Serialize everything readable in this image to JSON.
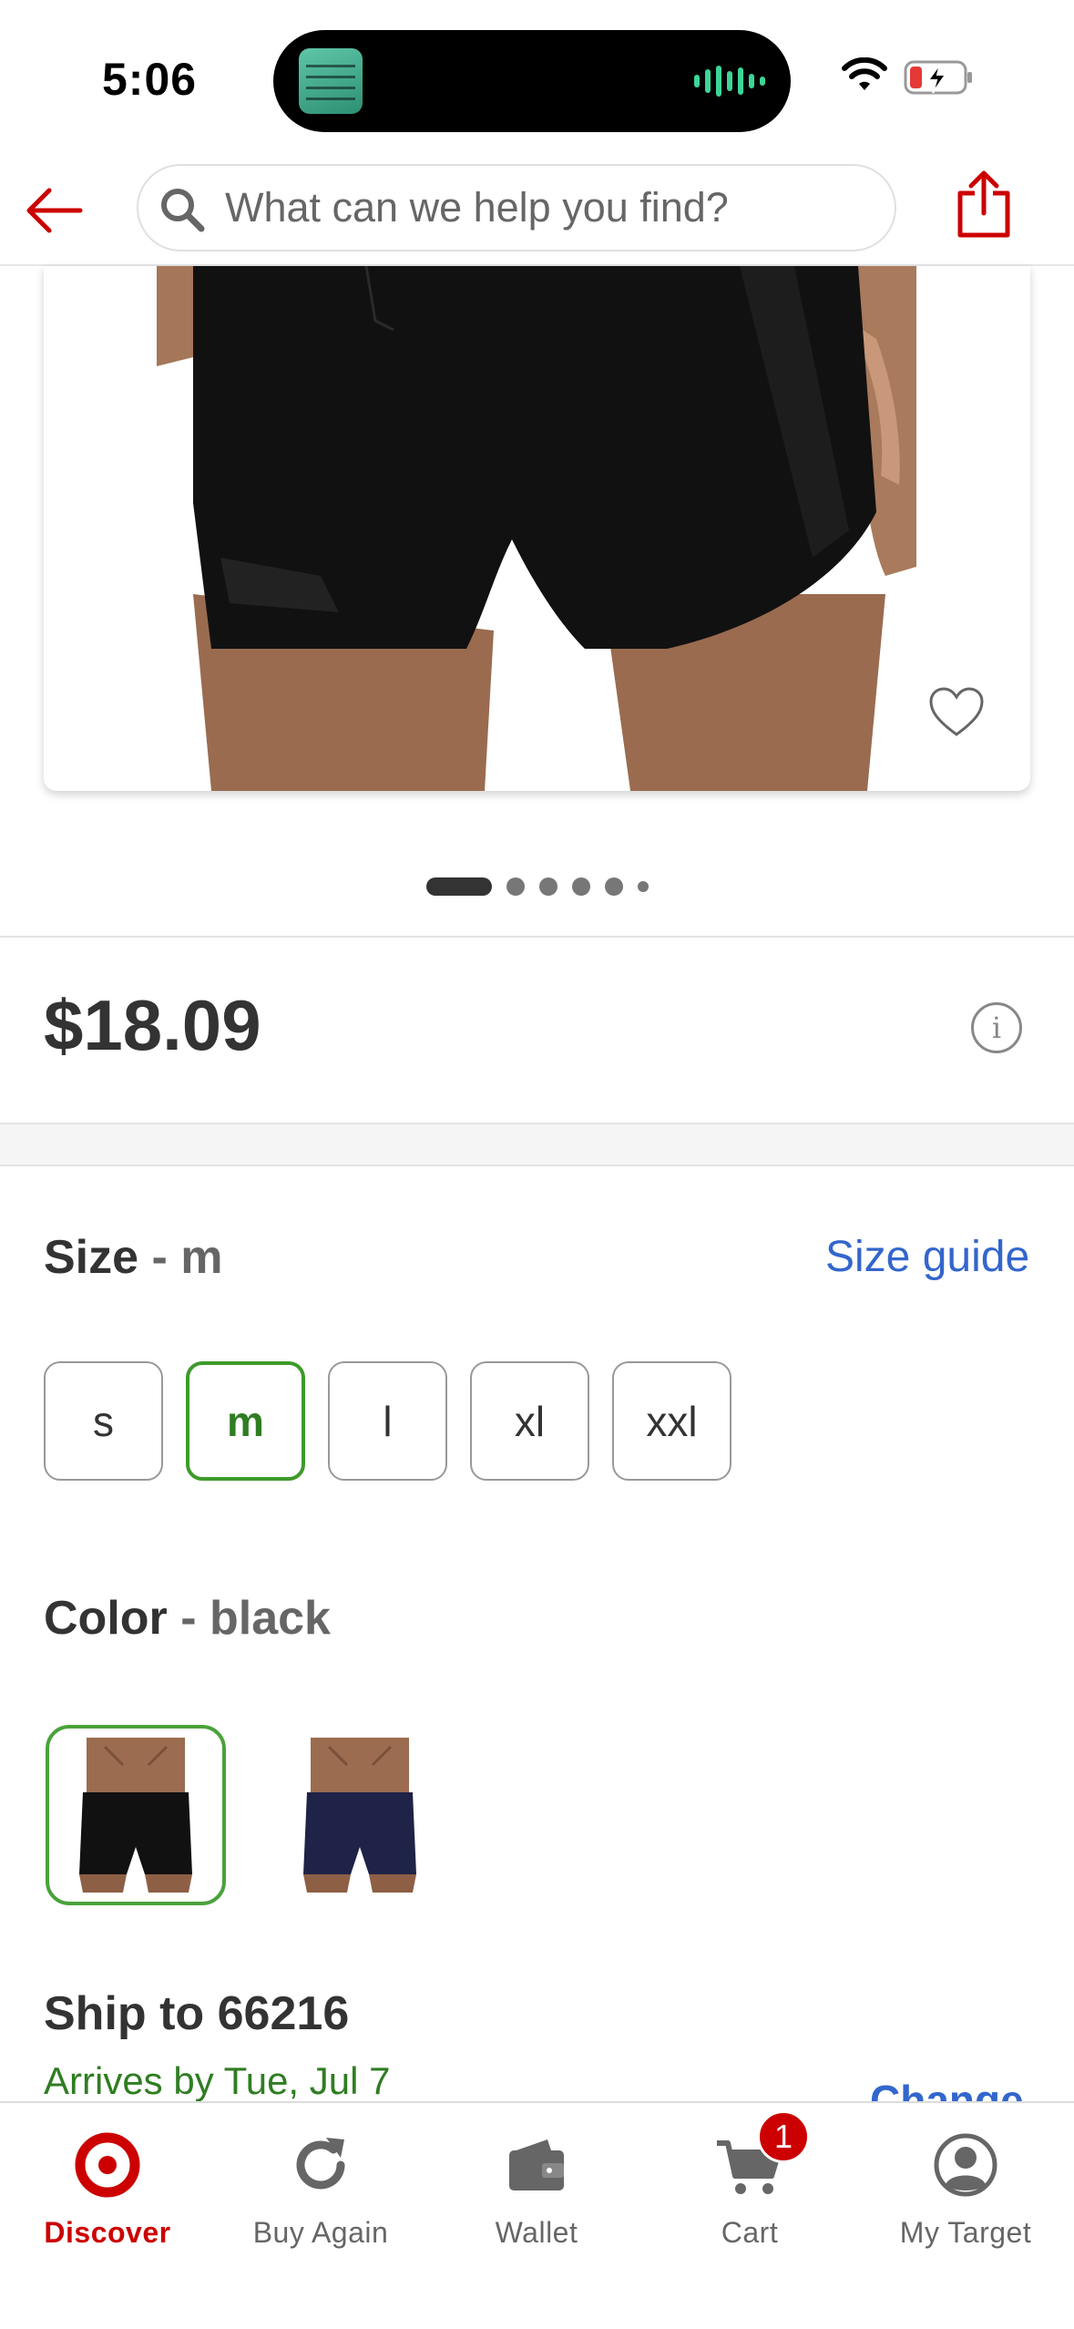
{
  "status_bar": {
    "time": "5:06",
    "icons": [
      "now-playing-album-art",
      "audio-waveform-icon",
      "wifi-icon",
      "battery-low-charging-icon"
    ]
  },
  "header": {
    "search_placeholder": "What can we help you find?",
    "icons": [
      "back-arrow-icon",
      "search-icon",
      "share-icon"
    ]
  },
  "product": {
    "image_icons": [
      "heart-icon"
    ],
    "carousel": {
      "total_images": 6,
      "active_index": 0
    },
    "price": "$18.09",
    "price_info_symbol": "i"
  },
  "size": {
    "label": "Size",
    "separator": "-",
    "selected": "m",
    "guide_link": "Size guide",
    "options": [
      "s",
      "m",
      "l",
      "xl",
      "xxl"
    ]
  },
  "color": {
    "label": "Color",
    "separator": "-",
    "selected": "black",
    "swatch_colors": [
      "#111111",
      "#1e2347"
    ]
  },
  "shipping": {
    "title": "Ship to 66216",
    "arrives": "Arrives by Tue, Jul 7",
    "change_link": "Change"
  },
  "bottom_nav": {
    "items": [
      {
        "label": "Discover",
        "icon": "target-bullseye-icon",
        "active": true
      },
      {
        "label": "Buy Again",
        "icon": "refresh-icon",
        "active": false
      },
      {
        "label": "Wallet",
        "icon": "wallet-icon",
        "active": false
      },
      {
        "label": "Cart",
        "icon": "cart-icon",
        "active": false,
        "badge": "1"
      },
      {
        "label": "My Target",
        "icon": "user-circle-icon",
        "active": false
      }
    ]
  },
  "colors": {
    "brand_red": "#cc0000",
    "link_blue": "#3366cc",
    "selected_green": "#3e9a2a"
  }
}
